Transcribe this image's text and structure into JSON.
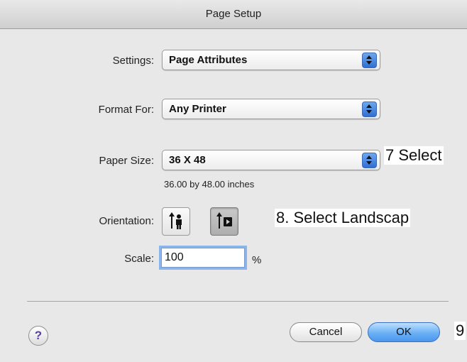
{
  "window": {
    "title": "Page Setup"
  },
  "settings": {
    "label": "Settings:",
    "value": "Page Attributes"
  },
  "format_for": {
    "label": "Format For:",
    "value": "Any Printer"
  },
  "paper_size": {
    "label": "Paper Size:",
    "value": "36 X 48",
    "dimensions": "36.00 by 48.00 inches"
  },
  "orientation": {
    "label": "Orientation:",
    "selected": "landscape"
  },
  "scale": {
    "label": "Scale:",
    "value": "100",
    "unit": "%"
  },
  "buttons": {
    "cancel": "Cancel",
    "ok": "OK",
    "help": "?"
  },
  "annotations": {
    "step7": "7 Select",
    "step8": "8. Select Landscap",
    "step9": "9"
  },
  "colors": {
    "ok_button": "#5aa4f2",
    "focus_ring": "#8ab4ec",
    "popup_arrows": "#2f6fd3"
  }
}
